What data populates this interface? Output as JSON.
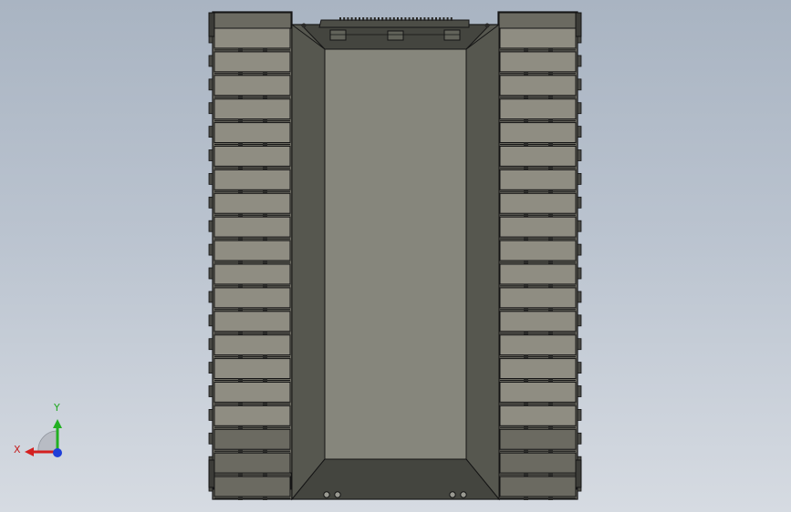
{
  "viewport": {
    "background_top": "#a9b4c2",
    "background_bottom": "#d6dbe2"
  },
  "model": {
    "name": "tracked-chassis",
    "view": "top",
    "colors": {
      "outline": "#151515",
      "track_plate": "#8f8d82",
      "track_plate_dark": "#6b6a61",
      "hull_floor": "#86867c",
      "hull_wall": "#56574f",
      "hull_wall_dark": "#44453f"
    },
    "track_plate_count": 20
  },
  "triad": {
    "x_label": "X",
    "y_label": "Y",
    "x_color": "#d42020",
    "y_color": "#22b022",
    "z_color": "#1f3fd8"
  }
}
